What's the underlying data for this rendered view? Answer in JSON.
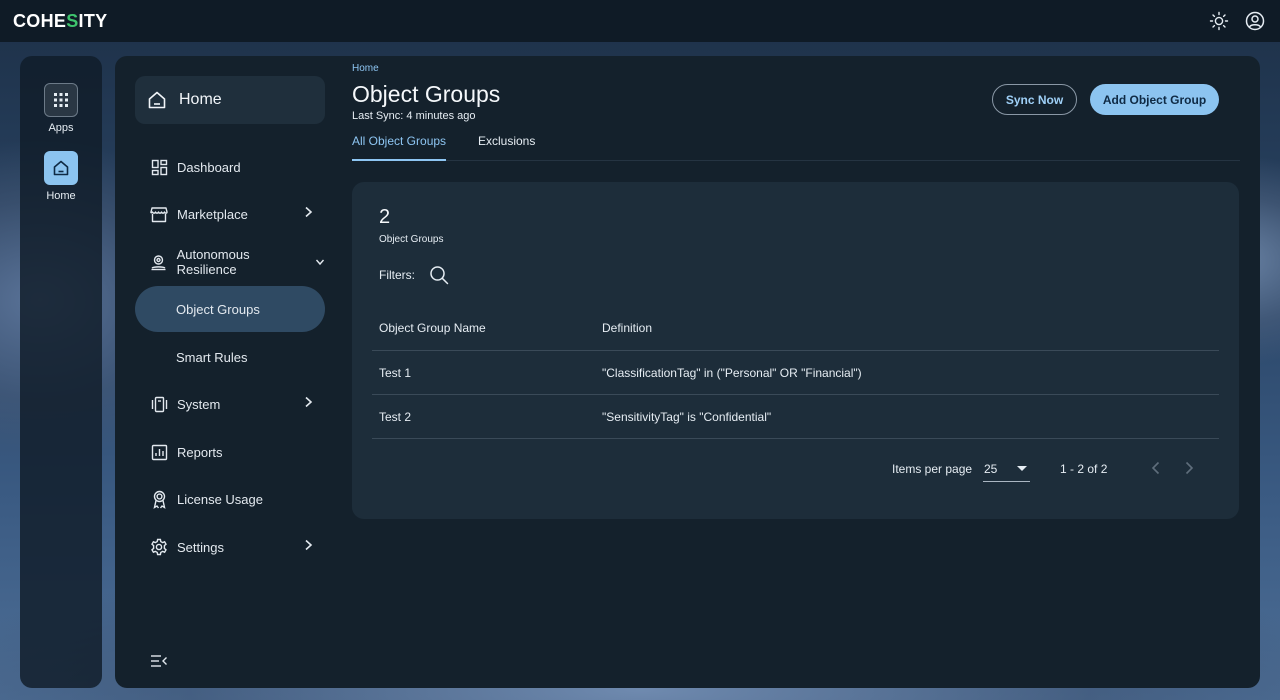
{
  "header": {
    "logo_left": "COHE",
    "logo_accent": "S",
    "logo_right": "ITY",
    "icons": [
      "theme-sun-icon",
      "user-account-icon"
    ]
  },
  "rail": {
    "apps_label": "Apps",
    "home_label": "Home"
  },
  "sidebar": {
    "home_label": "Home",
    "items": [
      {
        "label": "Dashboard",
        "icon": "dashboard-icon"
      },
      {
        "label": "Marketplace",
        "icon": "store-icon",
        "chevron": "right"
      },
      {
        "label": "Autonomous Resilience",
        "icon": "resilience-icon",
        "chevron": "down"
      },
      {
        "label": "Object Groups",
        "active": true
      },
      {
        "label": "Smart Rules"
      },
      {
        "label": "System",
        "icon": "system-icon",
        "chevron": "right"
      },
      {
        "label": "Reports",
        "icon": "reports-icon"
      },
      {
        "label": "License Usage",
        "icon": "license-icon"
      },
      {
        "label": "Settings",
        "icon": "gear-icon",
        "chevron": "right"
      }
    ]
  },
  "page": {
    "breadcrumb": "Home",
    "title": "Object Groups",
    "subtitle": "Last Sync: 4 minutes ago",
    "sync_button": "Sync Now",
    "add_button": "Add Object Group",
    "tabs": [
      "All Object Groups",
      "Exclusions"
    ]
  },
  "card": {
    "count": "2",
    "count_label": "Object Groups",
    "filters_label": "Filters:",
    "columns": [
      "Object Group Name",
      "Definition"
    ],
    "rows": [
      {
        "name": "Test 1",
        "definition": "\"ClassificationTag\" in (\"Personal\" OR \"Financial\")"
      },
      {
        "name": "Test 2",
        "definition": "\"SensitivityTag\" is \"Confidential\""
      }
    ],
    "pager": {
      "items_per_page_label": "Items per page",
      "items_per_page_value": "25",
      "range": "1 - 2 of 2"
    }
  },
  "colors": {
    "accent": "#8cc4f0",
    "logo_accent": "#3ec46d",
    "panel": "#14212c",
    "card": "#1d2d3a"
  }
}
